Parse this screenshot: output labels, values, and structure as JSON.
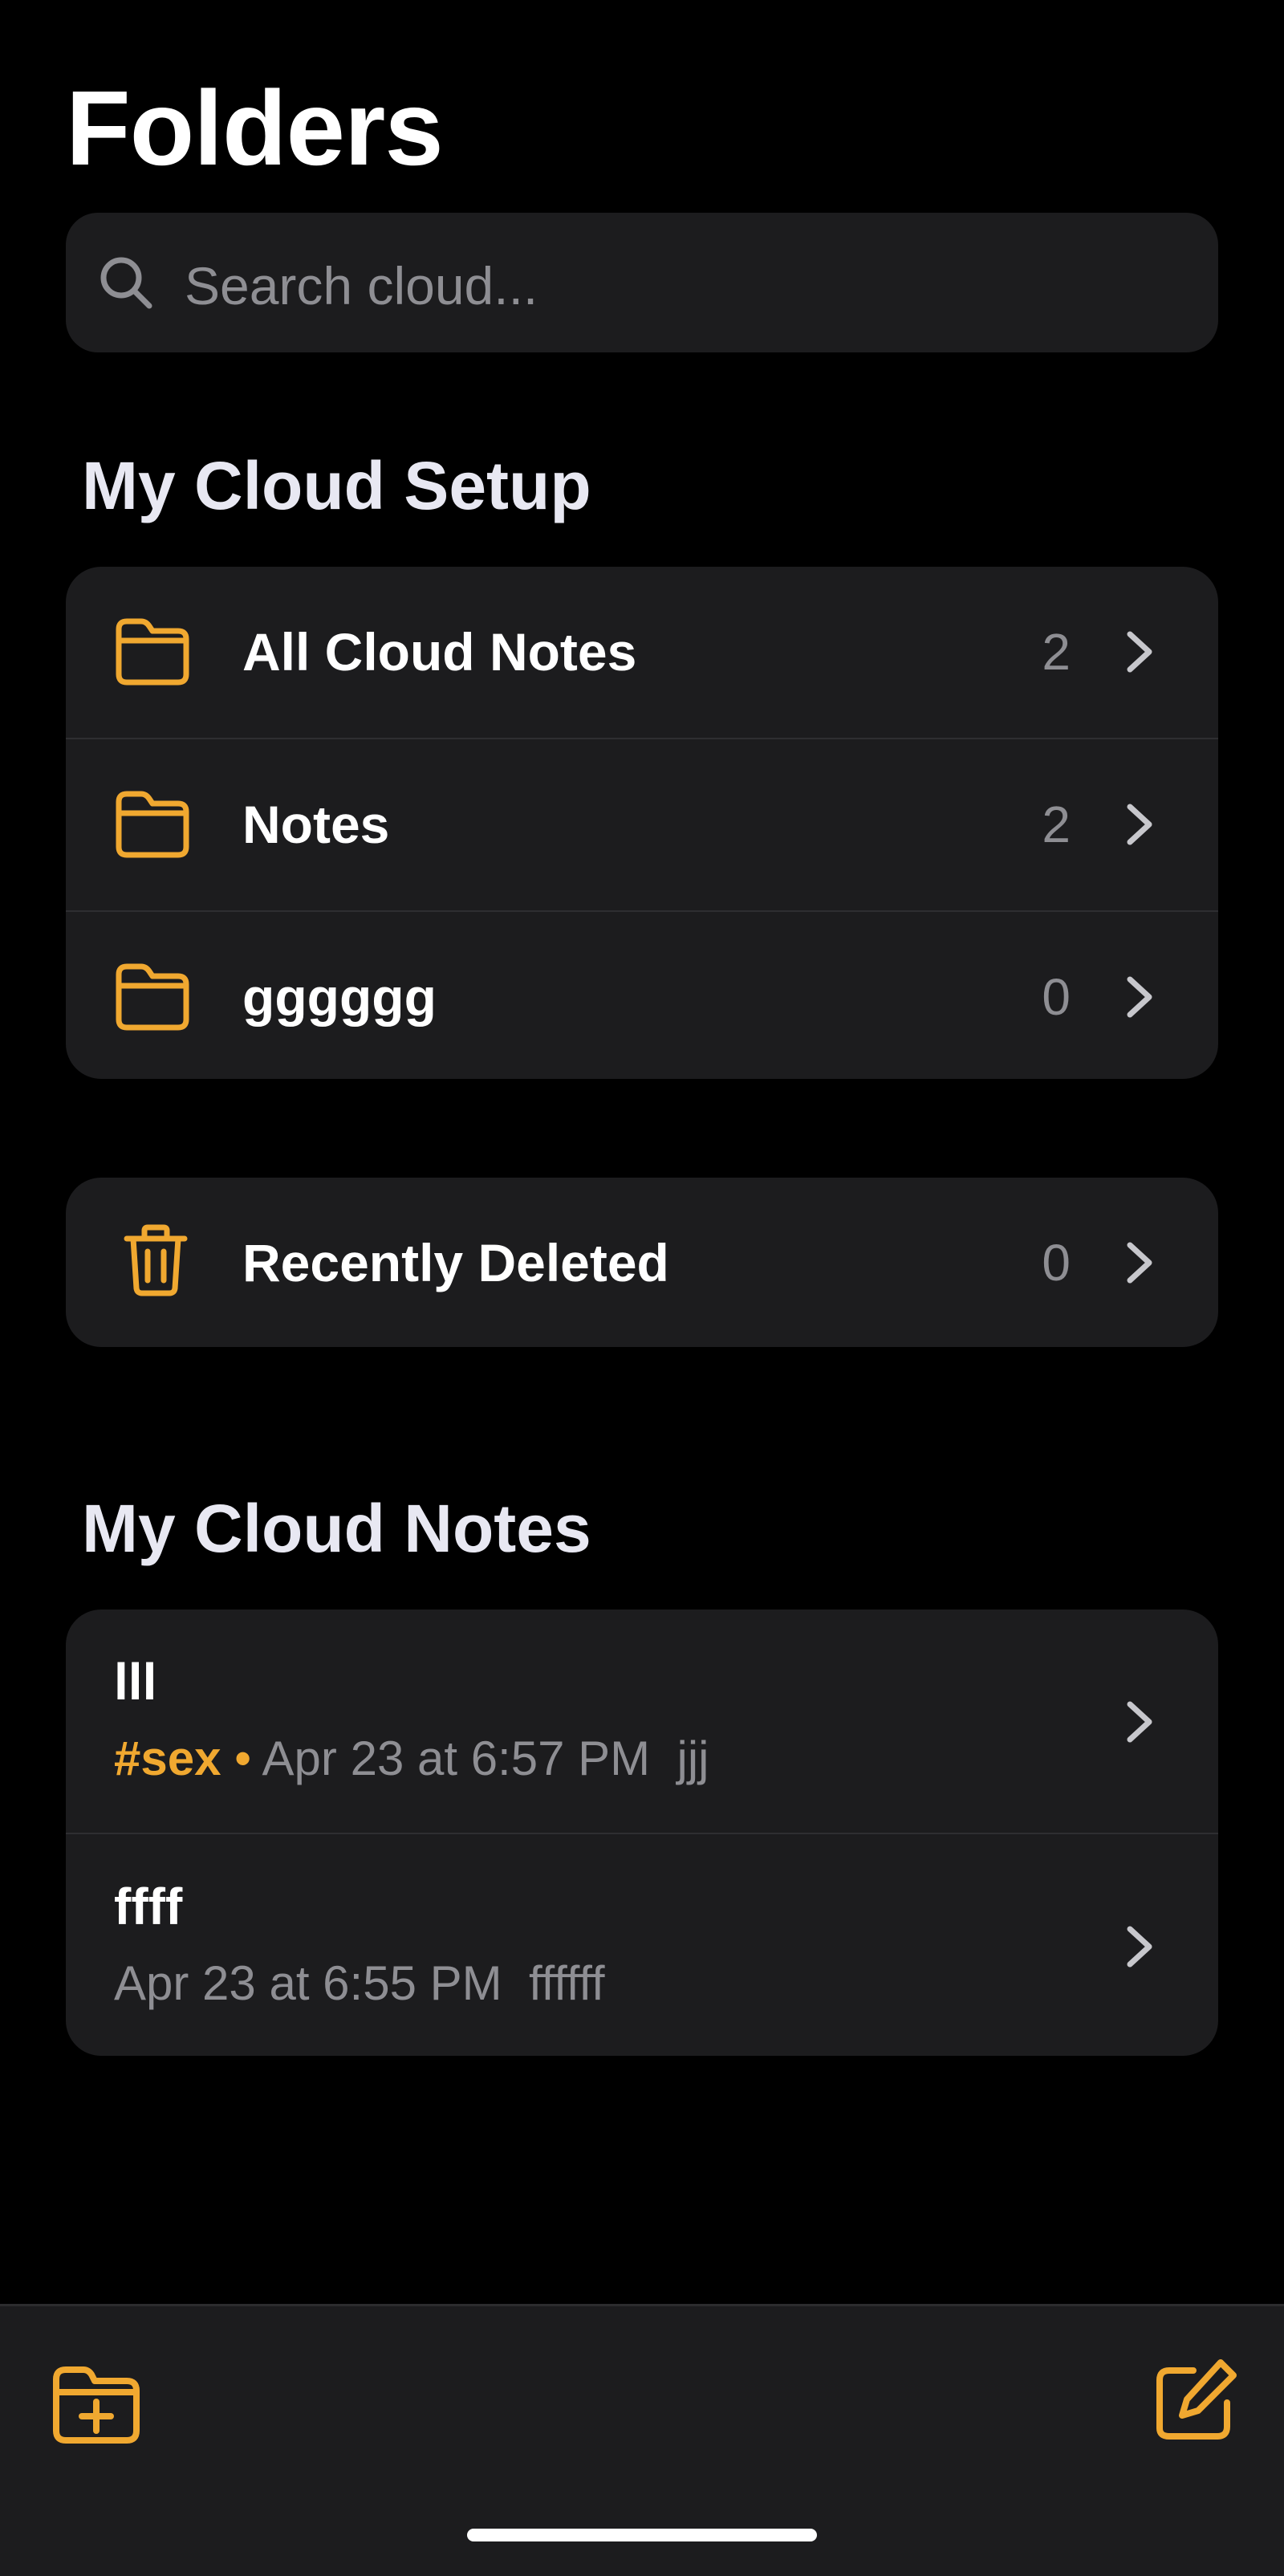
{
  "header": {
    "title": "Folders"
  },
  "search": {
    "placeholder": "Search cloud...",
    "value": ""
  },
  "setup_section": {
    "title": "My Cloud Setup",
    "folders": [
      {
        "label": "All Cloud Notes",
        "count": "2",
        "icon": "folder-icon"
      },
      {
        "label": "Notes",
        "count": "2",
        "icon": "folder-icon"
      },
      {
        "label": "gggggg",
        "count": "0",
        "icon": "folder-icon"
      }
    ],
    "deleted": {
      "label": "Recently Deleted",
      "count": "0",
      "icon": "trash-icon"
    }
  },
  "notes_section": {
    "title": "My Cloud Notes",
    "notes": [
      {
        "title": "lll",
        "tag": "#sex",
        "separator": "•",
        "date": "Apr 23 at 6:57 PM",
        "preview": "jjj"
      },
      {
        "title": "ffff",
        "tag": "",
        "separator": "",
        "date": "Apr 23 at 6:55 PM",
        "preview": "ffffff"
      }
    ]
  },
  "toolbar": {
    "new_folder_icon": "folder-plus-icon",
    "compose_icon": "compose-icon"
  },
  "colors": {
    "accent": "#f0a830",
    "background": "#000000",
    "card": "#1c1c1e",
    "secondary_text": "#8e8e93"
  }
}
